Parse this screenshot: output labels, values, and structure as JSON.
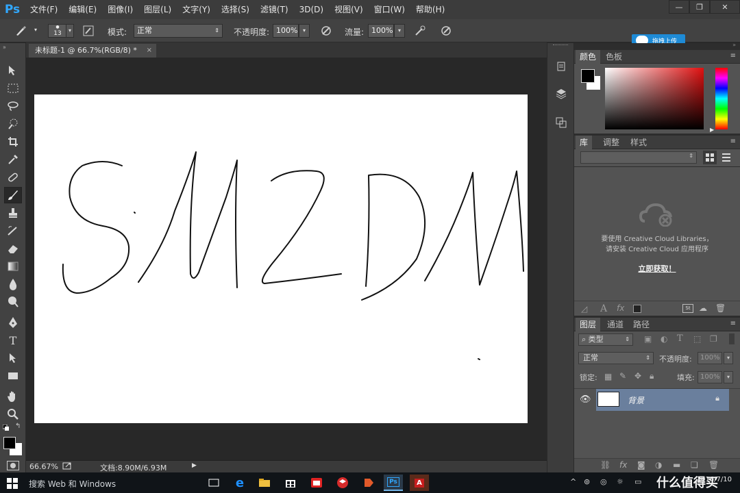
{
  "app": {
    "logo": "Ps"
  },
  "menu": [
    "文件(F)",
    "编辑(E)",
    "图像(I)",
    "图层(L)",
    "文字(Y)",
    "选择(S)",
    "滤镜(T)",
    "3D(D)",
    "视图(V)",
    "窗口(W)",
    "帮助(H)"
  ],
  "window_controls": {
    "minimize": "—",
    "restore": "❐",
    "close": "✕"
  },
  "options": {
    "brush_size": "13",
    "mode_label": "模式:",
    "mode_value": "正常",
    "opacity_label": "不透明度:",
    "opacity_value": "100%",
    "flow_label": "流量:",
    "flow_value": "100%",
    "upload_label": "拖拽上传"
  },
  "document": {
    "tab_title": "未标题-1 @ 66.7%(RGB/8) *",
    "tab_close": "×",
    "canvas_text": "SMZDM"
  },
  "status": {
    "zoom": "66.67%",
    "doc_info": "文档:8.90M/6.93M",
    "arrow": "▶"
  },
  "panels": {
    "color_tabs": [
      "颜色",
      "色板"
    ],
    "library_tabs": [
      "库",
      "调整",
      "样式"
    ],
    "library_message_line1": "要使用 Creative Cloud Libraries，",
    "library_message_line2": "请安装 Creative Cloud 应用程序",
    "library_link": "立即获取！",
    "layers_tabs": [
      "图层",
      "通道",
      "路径"
    ],
    "layer_filter": "类型",
    "blend_mode": "正常",
    "layer_opacity_label": "不透明度:",
    "layer_opacity_value": "100%",
    "lock_label": "锁定:",
    "fill_label": "填充:",
    "fill_value": "100%",
    "layer_name": "背景"
  },
  "colors": {
    "accent": "#31a8ff",
    "foreground": "#000000",
    "background": "#ffffff",
    "selected_layer": "#6a7f9d"
  },
  "taskbar": {
    "search_placeholder": "搜索 Web 和 Windows",
    "time": "",
    "date": "2016/7/10",
    "watermark": "什么值得买"
  },
  "icons": [
    "brush-icon",
    "move-icon",
    "marquee-icon",
    "lasso-icon",
    "quick-select-icon",
    "crop-icon",
    "eyedropper-icon",
    "healing-icon",
    "stamp-icon",
    "history-brush-icon",
    "eraser-icon",
    "gradient-icon",
    "blur-icon",
    "dodge-icon",
    "pen-icon",
    "type-icon",
    "path-select-icon",
    "rectangle-icon",
    "hand-icon",
    "zoom-icon",
    "eye-icon",
    "lock-icon",
    "creative-cloud-icon"
  ]
}
